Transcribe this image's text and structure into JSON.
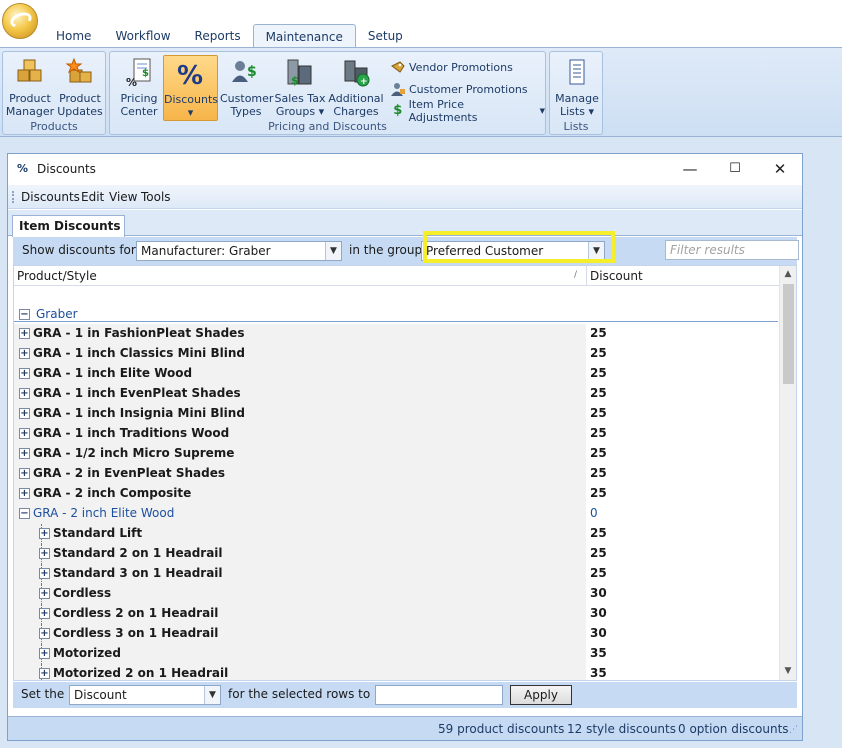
{
  "ribbon": {
    "tabs": [
      {
        "label": "Home",
        "active": false
      },
      {
        "label": "Workflow",
        "active": false
      },
      {
        "label": "Reports",
        "active": false
      },
      {
        "label": "Maintenance",
        "active": true
      },
      {
        "label": "Setup",
        "active": false
      }
    ],
    "groups": {
      "products": {
        "label": "Products",
        "buttons": [
          {
            "line1": "Product",
            "line2": "Manager",
            "icon": "boxes-icon"
          },
          {
            "line1": "Product",
            "line2": "Updates",
            "icon": "box-star-icon"
          }
        ]
      },
      "pricing": {
        "label": "Pricing and Discounts",
        "buttons": [
          {
            "line1": "Pricing",
            "line2": "Center",
            "icon": "pricing-center-icon"
          },
          {
            "line1": "Discounts",
            "line2": "▾",
            "icon": "percent-icon",
            "active": true
          },
          {
            "line1": "Customer",
            "line2": "Types",
            "icon": "customer-types-icon"
          },
          {
            "line1": "Sales Tax",
            "line2": "Groups ▾",
            "icon": "sales-tax-icon"
          },
          {
            "line1": "Additional",
            "line2": "Charges",
            "icon": "additional-charges-icon"
          }
        ],
        "small_buttons": [
          {
            "label": "Vendor Promotions",
            "icon": "vendor-promotions-icon"
          },
          {
            "label": "Customer Promotions",
            "icon": "customer-promotions-icon"
          },
          {
            "label": "Item Price Adjustments",
            "icon": "dollar-icon",
            "dropdown": true
          }
        ]
      },
      "lists": {
        "label": "Lists",
        "buttons": [
          {
            "line1": "Manage",
            "line2": "Lists ▾",
            "icon": "manage-lists-icon"
          }
        ]
      }
    }
  },
  "window": {
    "icon_text": "%",
    "title": "Discounts",
    "controls": {
      "minimize": "—",
      "maximize": "☐",
      "close": "✕"
    },
    "menu": [
      "Discounts",
      "Edit",
      "View",
      "Tools"
    ],
    "tab": "Item Discounts",
    "filter": {
      "show_label": "Show discounts for",
      "show_value": "Manufacturer: Graber",
      "group_label": "in the group",
      "group_value": "Preferred Customer",
      "search_placeholder": "Filter results"
    },
    "grid": {
      "columns": [
        "Product/Style",
        "Discount"
      ],
      "sort_glyph": "/",
      "group_name": "Graber",
      "rows": [
        {
          "name": "GRA - 1 in FashionPleat Shades",
          "discount": "25",
          "level": 0,
          "expanded": false
        },
        {
          "name": "GRA - 1 inch Classics Mini Blind",
          "discount": "25",
          "level": 0,
          "expanded": false
        },
        {
          "name": "GRA - 1 inch Elite Wood",
          "discount": "25",
          "level": 0,
          "expanded": false
        },
        {
          "name": "GRA - 1 inch EvenPleat Shades",
          "discount": "25",
          "level": 0,
          "expanded": false
        },
        {
          "name": "GRA - 1 inch Insignia Mini Blind",
          "discount": "25",
          "level": 0,
          "expanded": false
        },
        {
          "name": "GRA - 1 inch Traditions Wood",
          "discount": "25",
          "level": 0,
          "expanded": false
        },
        {
          "name": "GRA - 1/2 inch Micro Supreme",
          "discount": "25",
          "level": 0,
          "expanded": false
        },
        {
          "name": "GRA - 2 in EvenPleat Shades",
          "discount": "25",
          "level": 0,
          "expanded": false
        },
        {
          "name": "GRA - 2 inch Composite",
          "discount": "25",
          "level": 0,
          "expanded": false
        },
        {
          "name": "GRA - 2 inch Elite Wood",
          "discount": "0",
          "level": 0,
          "expanded": true
        },
        {
          "name": "Standard Lift",
          "discount": "25",
          "level": 1,
          "expanded": false
        },
        {
          "name": "Standard 2 on 1 Headrail",
          "discount": "25",
          "level": 1,
          "expanded": false
        },
        {
          "name": "Standard 3 on 1 Headrail",
          "discount": "25",
          "level": 1,
          "expanded": false
        },
        {
          "name": "Cordless",
          "discount": "30",
          "level": 1,
          "expanded": false
        },
        {
          "name": "Cordless 2 on 1 Headrail",
          "discount": "30",
          "level": 1,
          "expanded": false
        },
        {
          "name": "Cordless 3 on 1 Headrail",
          "discount": "30",
          "level": 1,
          "expanded": false
        },
        {
          "name": "Motorized",
          "discount": "35",
          "level": 1,
          "expanded": false
        },
        {
          "name": "Motorized 2 on 1 Headrail",
          "discount": "35",
          "level": 1,
          "expanded": false
        }
      ]
    },
    "setbar": {
      "set_label": "Set the",
      "set_value": "Discount",
      "rows_label": "for the selected rows to",
      "apply_label": "Apply"
    },
    "status": {
      "product_discounts": "59 product discounts",
      "style_discounts": "12 style discounts",
      "option_discounts": "0 option discounts"
    }
  },
  "colors": {
    "highlight": "#f5ee2a",
    "link_blue": "#1c4f9c",
    "active_button": "#f7b54a"
  }
}
